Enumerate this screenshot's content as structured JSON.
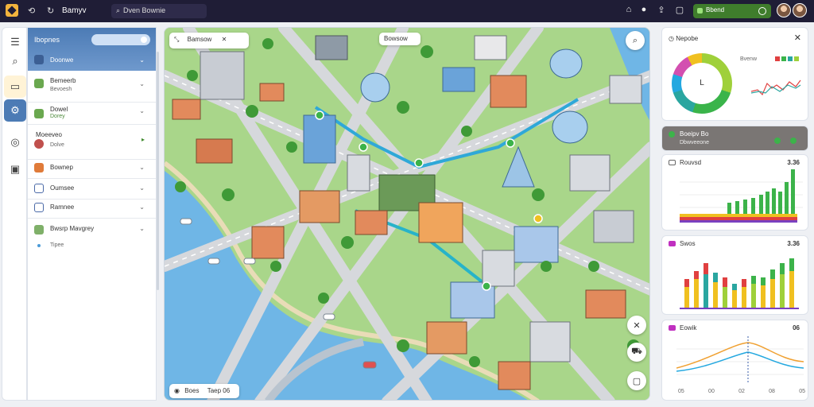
{
  "topbar": {
    "brand": "Bamyv",
    "search_text": "Dven Bownie",
    "status_text": "Bbend"
  },
  "left_panel": {
    "header_title": "Ibopnes",
    "rows": [
      {
        "title": "Doonwe",
        "sub": "",
        "icon_color": "#4b6aa8"
      },
      {
        "title": "Bemeerb",
        "sub": "Bevoesh",
        "icon_color": "#6aa84f"
      },
      {
        "title": "Dowel",
        "sub": "Dorey",
        "icon_color": "#6aa84f"
      },
      {
        "title": "Moeeveo",
        "sub": "Dolve",
        "icon_color": "#c0504d"
      },
      {
        "title": "Bownep",
        "sub": "",
        "icon_color": "#e07b39"
      },
      {
        "title": "Oumsee",
        "sub": "",
        "icon_color": "#4b6aa8"
      },
      {
        "title": "Ramnee",
        "sub": "",
        "icon_color": "#4b6aa8"
      },
      {
        "title": "Bwsrp Mavgrey",
        "sub": "Tipee",
        "icon_color": "#7fb069"
      }
    ]
  },
  "map": {
    "top_chip": "Bamsow",
    "top_chip_right": "Bowsow",
    "bottom_chip_a": "Boes",
    "bottom_chip_b": "Taep 06"
  },
  "cards": {
    "donut": {
      "title": "Nepobe",
      "center": "L",
      "label": "Bvenw"
    },
    "info": {
      "title": "Boeipv Bo",
      "sub": "Dbwveeone"
    },
    "bars1": {
      "title": "Rouvsd",
      "value": "3.36"
    },
    "bars2": {
      "title": "Swos",
      "value": "3.36"
    },
    "line": {
      "title": "Eowik",
      "value": "06"
    },
    "line_xticks": [
      "05",
      "00",
      "02",
      "08",
      "05"
    ]
  },
  "colors": {
    "accent": "#4c7bb5",
    "status_green": "#3f7d2c",
    "topbar": "#1f1d36"
  }
}
